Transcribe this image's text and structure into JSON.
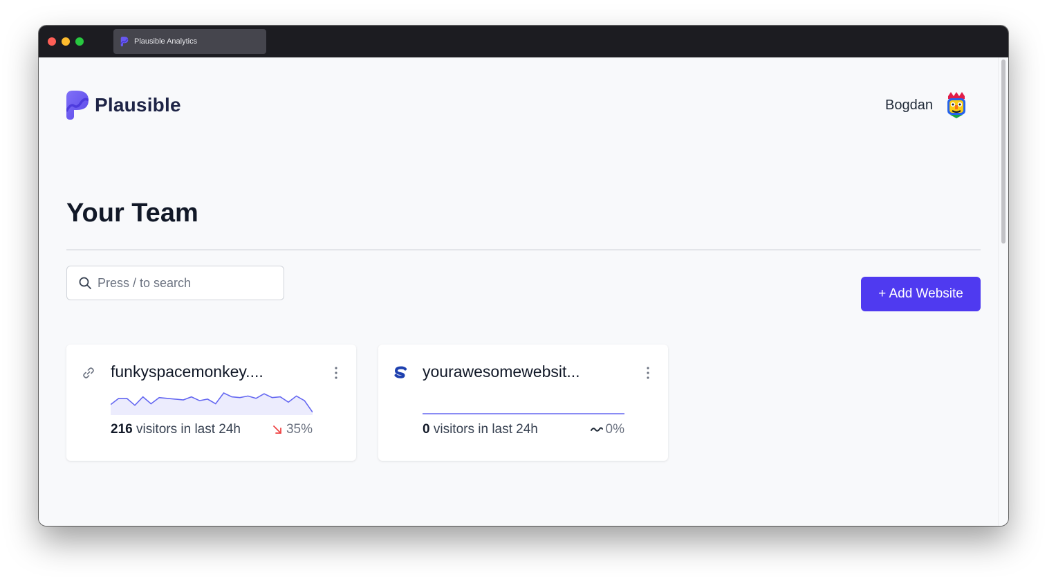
{
  "browser": {
    "tab_title": "Plausible Analytics"
  },
  "header": {
    "logo_text": "Plausible",
    "user_name": "Bogdan"
  },
  "page": {
    "title": "Your Team"
  },
  "search": {
    "placeholder": "Press / to search",
    "value": ""
  },
  "actions": {
    "add_website_label": "+ Add Website"
  },
  "sites": [
    {
      "name": "funkyspacemonkey....",
      "icon": "link-icon",
      "visitors": "216",
      "visitors_label": "visitors in last 24h",
      "change": "35%",
      "change_direction": "down",
      "sparkline": [
        12,
        20,
        20,
        11,
        22,
        13,
        21,
        20,
        19,
        18,
        22,
        17,
        19,
        13,
        27,
        22,
        21,
        23,
        20,
        26,
        21,
        22,
        15,
        23,
        17,
        2
      ]
    },
    {
      "name": "yourawesomewebsit...",
      "icon": "s-logo-icon",
      "visitors": "0",
      "visitors_label": "visitors in last 24h",
      "change": "0%",
      "change_direction": "flat",
      "sparkline": [
        0,
        0,
        0,
        0,
        0,
        0,
        0,
        0,
        0,
        0,
        0,
        0,
        0,
        0,
        0,
        0,
        0,
        0,
        0,
        0,
        0,
        0,
        0,
        0
      ]
    }
  ],
  "colors": {
    "accent": "#4f3af0",
    "sparkline": "#6366f1",
    "change_down": "#ef4444",
    "text_dark": "#111827"
  }
}
